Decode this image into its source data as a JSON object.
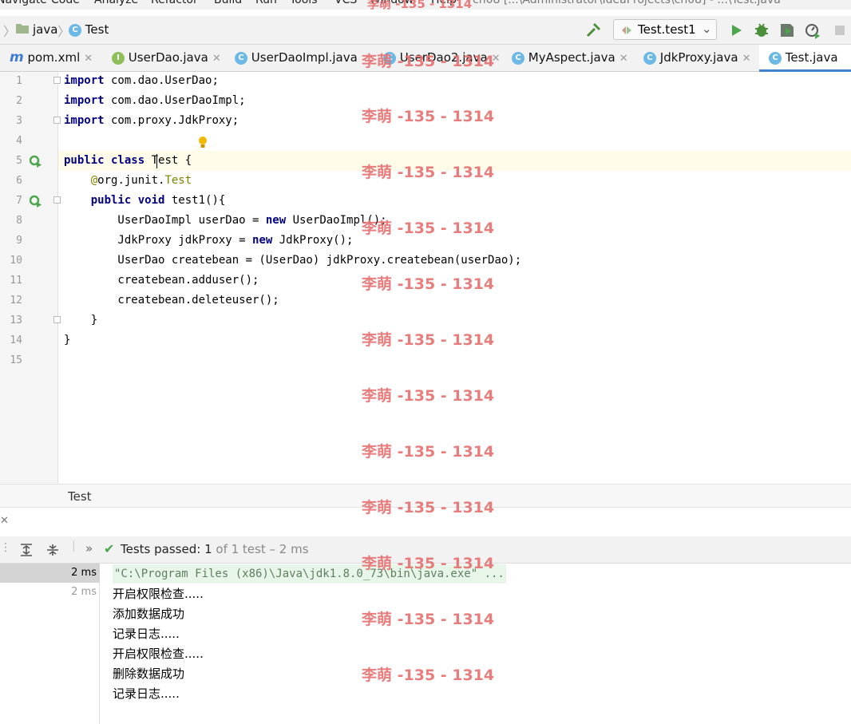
{
  "menu": [
    "Navigate",
    "Code",
    "Analyze",
    "Refactor",
    "Build",
    "Run",
    "Tools",
    "VCS",
    "Window",
    "Help"
  ],
  "window_title": "ch08 [...\\Administrator\\IdeaProjects\\ch08] - ...\\Test.java",
  "breadcrumb": {
    "folder": "java",
    "class": "Test"
  },
  "run_config": "Test.test1",
  "tabs": [
    {
      "label": "pom.xml",
      "icon": "maven-icon"
    },
    {
      "label": "UserDao.java",
      "icon": "interface-icon"
    },
    {
      "label": "UserDaoImpl.java",
      "icon": "class-icon"
    },
    {
      "label": "UserDao2.java",
      "icon": "class-icon"
    },
    {
      "label": "MyAspect.java",
      "icon": "class-icon"
    },
    {
      "label": "JdkProxy.java",
      "icon": "class-icon"
    },
    {
      "label": "Test.java",
      "icon": "class-icon",
      "active": true
    }
  ],
  "code_lines": [
    {
      "n": "1"
    },
    {
      "n": "2"
    },
    {
      "n": "3"
    },
    {
      "n": "4"
    },
    {
      "n": "5"
    },
    {
      "n": "6"
    },
    {
      "n": "7"
    },
    {
      "n": "8"
    },
    {
      "n": "9"
    },
    {
      "n": "10"
    },
    {
      "n": "11"
    },
    {
      "n": "12"
    },
    {
      "n": "13"
    },
    {
      "n": "14"
    },
    {
      "n": "15"
    }
  ],
  "code": {
    "l1a": "import",
    "l1b": " com.dao.UserDao;",
    "l2a": "import",
    "l2b": " com.dao.UserDaoImpl;",
    "l3a": "import",
    "l3b": " com.proxy.JdkProxy;",
    "l5a": "public class",
    "l5b": " Test {",
    "l6a": "    @",
    "l6b": "org.junit.",
    "l6c": "Test",
    "l7a": "    public void",
    "l7b": " test1(){",
    "l8a": "        UserDaoImpl userDao = ",
    "l8b": "new",
    "l8c": " UserDaoImpl();",
    "l9a": "        JdkProxy jdkProxy = ",
    "l9b": "new",
    "l9c": " JdkProxy();",
    "l10": "        UserDao createbean = (UserDao) jdkProxy.createbean(userDao);",
    "l11": "        createbean.adduser();",
    "l12": "        createbean.deleteuser();",
    "l13": "    }",
    "l14": "}"
  },
  "structure_label": "Test",
  "tests": {
    "status_prefix": "Tests passed:",
    "count": "1",
    "of_total": "of 1 test – 2 ms"
  },
  "tree_times": [
    "2 ms",
    "2 ms"
  ],
  "console": [
    "\"C:\\Program Files (x86)\\Java\\jdk1.8.0_73\\bin\\java.exe\" ...",
    "开启权限检查.....",
    "添加数据成功",
    "记录日志.....",
    "开启权限检查.....",
    "删除数据成功",
    "记录日志....."
  ],
  "watermark": "李萌 -135 - 1314",
  "colors": {
    "keyword": "#000080",
    "annotation": "#808000",
    "accent": "#4083c9",
    "watermark": "#e57373",
    "pass": "#4ca64c"
  }
}
